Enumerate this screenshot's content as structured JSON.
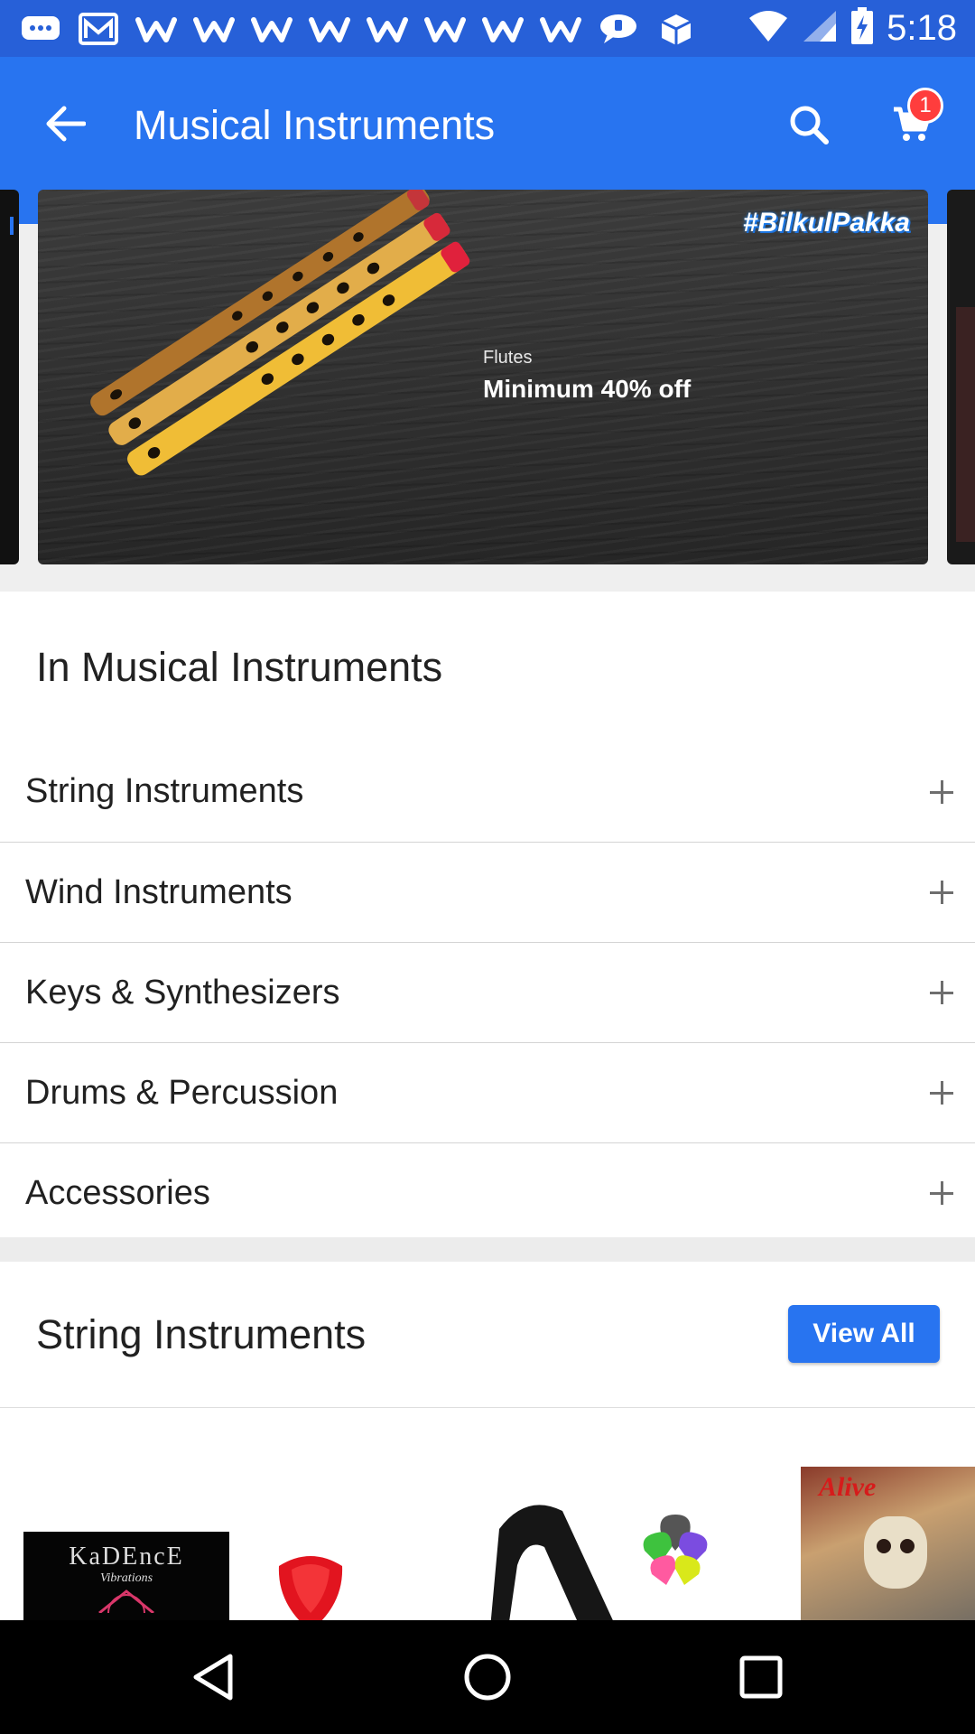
{
  "status_bar": {
    "time": "5:18",
    "icons": [
      "message-icon",
      "gmail-icon",
      "w-icon",
      "w-icon",
      "w-icon",
      "w-icon",
      "w-icon",
      "w-icon",
      "w-icon",
      "w-icon",
      "chat-bubble-icon",
      "box-icon"
    ],
    "right_icons": [
      "wifi-icon",
      "signal-icon",
      "battery-charging-icon"
    ]
  },
  "app_bar": {
    "title": "Musical Instruments",
    "cart_count": "1",
    "color": "#2874f0"
  },
  "banner": {
    "hashtag": "#BilkulPakka",
    "subtitle": "Flutes",
    "title": "Minimum 40% off"
  },
  "categories": {
    "heading": "In Musical Instruments",
    "items": [
      {
        "label": "String Instruments"
      },
      {
        "label": "Wind Instruments"
      },
      {
        "label": "Keys & Synthesizers"
      },
      {
        "label": "Drums & Percussion"
      },
      {
        "label": "Accessories"
      }
    ]
  },
  "string_section": {
    "title": "String Instruments",
    "view_all_label": "View All",
    "products": [
      {
        "brand": "KaDEncE",
        "tagline": "Vibrations"
      },
      {
        "name": "pick-holder"
      },
      {
        "name": "guitar-strap"
      },
      {
        "text": "Alive"
      }
    ]
  }
}
